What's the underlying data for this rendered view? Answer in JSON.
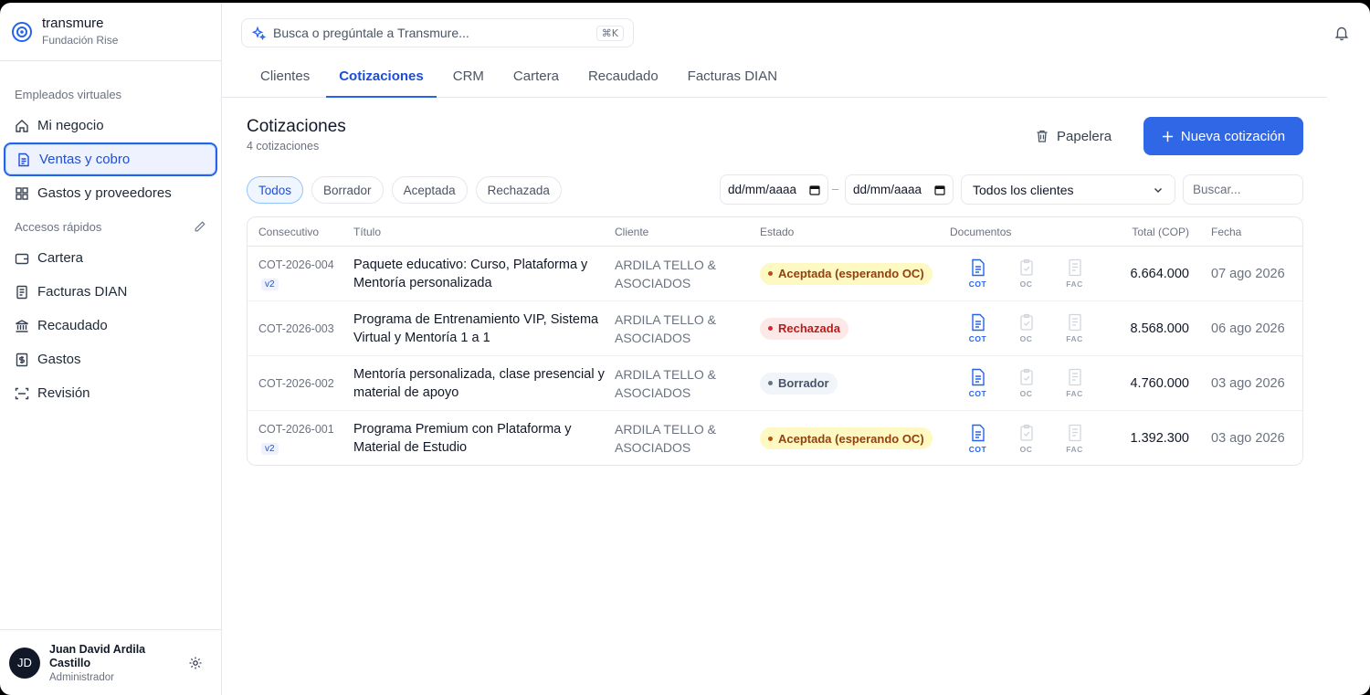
{
  "brand": {
    "name": "transmure",
    "org": "Fundación Rise"
  },
  "sidebar": {
    "section_employees": "Empleados virtuales",
    "employees": [
      {
        "label": "Mi negocio",
        "icon": "home-icon"
      },
      {
        "label": "Ventas y cobro",
        "icon": "document-icon",
        "active": true
      },
      {
        "label": "Gastos y proveedores",
        "icon": "grid-icon"
      }
    ],
    "section_shortcuts": "Accesos rápidos",
    "shortcuts": [
      {
        "label": "Cartera",
        "icon": "wallet-icon"
      },
      {
        "label": "Facturas DIAN",
        "icon": "invoice-icon"
      },
      {
        "label": "Recaudado",
        "icon": "bank-icon"
      },
      {
        "label": "Gastos",
        "icon": "dollar-icon"
      },
      {
        "label": "Revisión",
        "icon": "scan-icon"
      }
    ]
  },
  "user": {
    "initials": "JD",
    "name": "Juan David Ardila Castillo",
    "role": "Administrador"
  },
  "search": {
    "placeholder": "Busca o pregúntale a Transmure...",
    "shortcut": "⌘K"
  },
  "tabs": [
    "Clientes",
    "Cotizaciones",
    "CRM",
    "Cartera",
    "Recaudado",
    "Facturas DIAN"
  ],
  "active_tab": "Cotizaciones",
  "page": {
    "title": "Cotizaciones",
    "count": "4 cotizaciones",
    "trash_label": "Papelera",
    "new_label": "Nueva cotización"
  },
  "filters": {
    "chips": [
      "Todos",
      "Borrador",
      "Aceptada",
      "Rechazada"
    ],
    "active_chip": "Todos",
    "date_from": "dd/mm/aaaa",
    "date_to": "dd/mm/aaaa",
    "date_separator": "–",
    "client": "Todos los clientes",
    "search_placeholder": "Buscar..."
  },
  "table": {
    "headers": {
      "id": "Consecutivo",
      "title": "Título",
      "client": "Cliente",
      "state": "Estado",
      "docs": "Documentos",
      "total": "Total (COP)",
      "date": "Fecha"
    },
    "doc_labels": [
      "COT",
      "OC",
      "FAC"
    ],
    "rows": [
      {
        "id": "COT-2026-004",
        "version": "v2",
        "title": "Paquete educativo: Curso, Plataforma y Mentoría personalizada",
        "client": "ARDILA TELLO & ASOCIADOS",
        "state": "Aceptada (esperando OC)",
        "state_kind": "ok",
        "total": "6.664.000",
        "date": "07 ago 2026"
      },
      {
        "id": "COT-2026-003",
        "version": "",
        "title": "Programa de Entrenamiento VIP, Sistema Virtual y Mentoría 1 a 1",
        "client": "ARDILA TELLO & ASOCIADOS",
        "state": "Rechazada",
        "state_kind": "rej",
        "total": "8.568.000",
        "date": "06 ago 2026"
      },
      {
        "id": "COT-2026-002",
        "version": "",
        "title": "Mentoría personalizada, clase presencial y material de apoyo",
        "client": "ARDILA TELLO & ASOCIADOS",
        "state": "Borrador",
        "state_kind": "draft",
        "total": "4.760.000",
        "date": "03 ago 2026"
      },
      {
        "id": "COT-2026-001",
        "version": "v2",
        "title": "Programa Premium con Plataforma y Material de Estudio",
        "client": "ARDILA TELLO & ASOCIADOS",
        "state": "Aceptada (esperando OC)",
        "state_kind": "ok",
        "total": "1.392.300",
        "date": "03 ago 2026"
      }
    ]
  },
  "colors": {
    "accent": "#2f67e6",
    "active_text": "#1d4ed8"
  }
}
